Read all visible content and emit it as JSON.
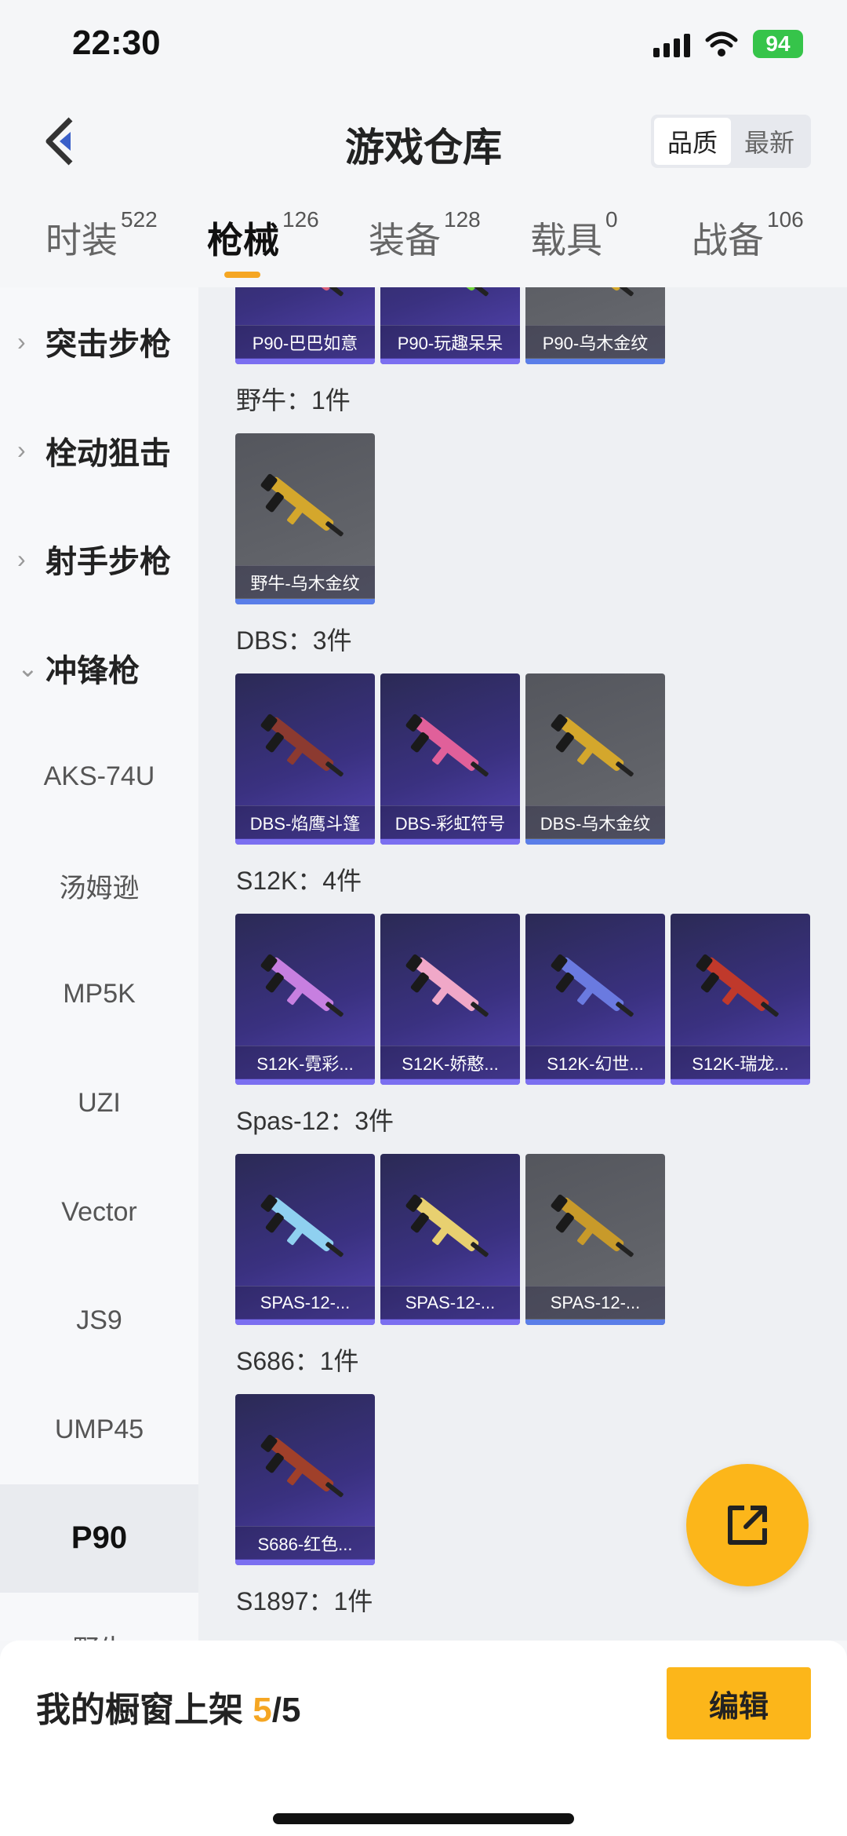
{
  "status_bar": {
    "time": "22:30",
    "battery": "94"
  },
  "header": {
    "title": "游戏仓库",
    "sort_options": [
      "品质",
      "最新"
    ]
  },
  "tabs": [
    {
      "label": "时装",
      "count": "522"
    },
    {
      "label": "枪械",
      "count": "126"
    },
    {
      "label": "装备",
      "count": "128"
    },
    {
      "label": "载具",
      "count": "0"
    },
    {
      "label": "战备",
      "count": "106"
    }
  ],
  "sidebar": {
    "categories": [
      "突击步枪",
      "栓动狙击",
      "射手步枪",
      "冲锋枪"
    ],
    "subitems": [
      "AKS-74U",
      "汤姆逊",
      "MP5K",
      "UZI",
      "Vector",
      "JS9",
      "UMP45",
      "P90",
      "野牛"
    ]
  },
  "groups": [
    {
      "label": "",
      "items": [
        {
          "name": "P90-巴巴如意",
          "style": "purple",
          "color": "#d8607a"
        },
        {
          "name": "P90-玩趣呆呆",
          "style": "purple",
          "color": "#6fd23a"
        },
        {
          "name": "P90-乌木金纹",
          "style": "grey",
          "color": "#d4a72c"
        }
      ]
    },
    {
      "label": "野牛：1件",
      "items": [
        {
          "name": "野牛-乌木金纹",
          "style": "grey",
          "color": "#d4a72c"
        }
      ]
    },
    {
      "label": "DBS：3件",
      "items": [
        {
          "name": "DBS-焰鹰斗篷",
          "style": "purple",
          "color": "#8c3a30"
        },
        {
          "name": "DBS-彩虹符号",
          "style": "purple",
          "color": "#e0609a"
        },
        {
          "name": "DBS-乌木金纹",
          "style": "grey",
          "color": "#d4a72c"
        }
      ]
    },
    {
      "label": "S12K：4件",
      "items": [
        {
          "name": "S12K-霓彩...",
          "style": "purple",
          "color": "#c77fe0"
        },
        {
          "name": "S12K-娇憨...",
          "style": "purple",
          "color": "#f0a8c8"
        },
        {
          "name": "S12K-幻世...",
          "style": "purple",
          "color": "#6a7ae0"
        },
        {
          "name": "S12K-瑞龙...",
          "style": "purple",
          "color": "#c0392b"
        }
      ]
    },
    {
      "label": "Spas-12：3件",
      "items": [
        {
          "name": "SPAS-12-...",
          "style": "purple",
          "color": "#8fd0f0"
        },
        {
          "name": "SPAS-12-...",
          "style": "purple",
          "color": "#e8d070"
        },
        {
          "name": "SPAS-12-...",
          "style": "grey",
          "color": "#c89a2a"
        }
      ]
    },
    {
      "label": "S686：1件",
      "items": [
        {
          "name": "S686-红色...",
          "style": "purple",
          "color": "#a0402a"
        }
      ]
    },
    {
      "label": "S1897：1件",
      "items": []
    }
  ],
  "bottom": {
    "showcase_label": "我的橱窗上架",
    "used": "5",
    "separator": "/",
    "total": "5",
    "edit_label": "编辑"
  }
}
